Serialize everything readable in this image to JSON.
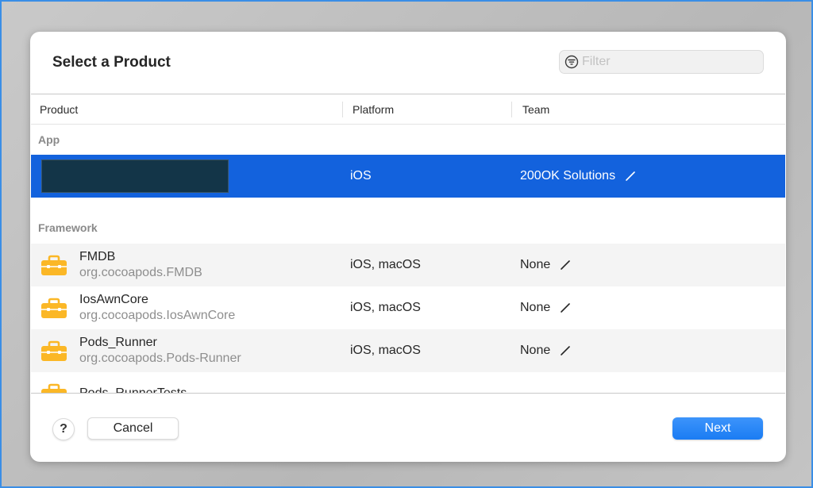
{
  "dialog": {
    "title": "Select a Product",
    "filter_placeholder": "Filter",
    "filter_value": ""
  },
  "table": {
    "columns": [
      "Product",
      "Platform",
      "Team"
    ],
    "groups": [
      {
        "label": "App",
        "items": [
          {
            "name": "[redacted]",
            "bundle_id": "",
            "platform": "iOS",
            "team": "200OK Solutions",
            "selected": true
          }
        ]
      },
      {
        "label": "Framework",
        "items": [
          {
            "name": "FMDB",
            "bundle_id": "org.cocoapods.FMDB",
            "platform": "iOS, macOS",
            "team": "None"
          },
          {
            "name": "IosAwnCore",
            "bundle_id": "org.cocoapods.IosAwnCore",
            "platform": "iOS, macOS",
            "team": "None"
          },
          {
            "name": "Pods_Runner",
            "bundle_id": "org.cocoapods.Pods-Runner",
            "platform": "iOS, macOS",
            "team": "None"
          },
          {
            "name": "Pods_RunnerTests",
            "bundle_id": "",
            "platform": "",
            "team": ""
          }
        ]
      }
    ]
  },
  "icons": {
    "filter": "filter-circle-icon",
    "edit": "pencil-icon",
    "framework": "toolbox-icon"
  },
  "footer": {
    "help_label": "?",
    "cancel_label": "Cancel",
    "next_label": "Next"
  },
  "colors": {
    "selection": "#1362dd",
    "primary_button": "#1a7cf3",
    "framework_icon": "#fbb726",
    "redaction": "#133548"
  }
}
